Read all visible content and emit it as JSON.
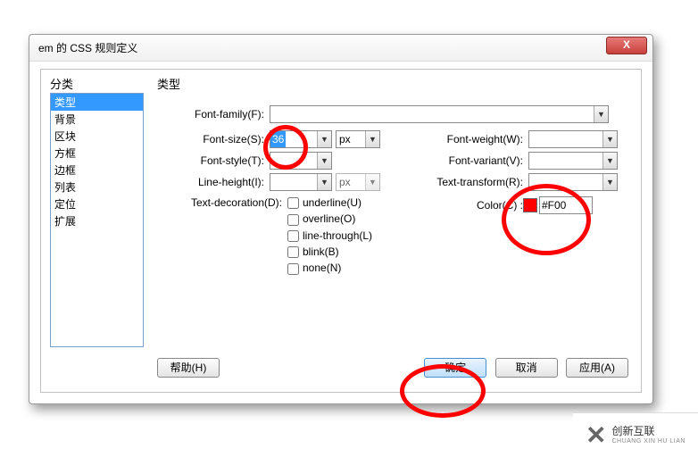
{
  "title": "em 的 CSS 规则定义",
  "close_x": "X",
  "headers": {
    "category": "分类",
    "type": "类型"
  },
  "categories": [
    "类型",
    "背景",
    "区块",
    "方框",
    "边框",
    "列表",
    "定位",
    "扩展"
  ],
  "labels": {
    "font_family": "Font-family(F):",
    "font_size": "Font-size(S):",
    "font_style": "Font-style(T):",
    "line_height": "Line-height(I):",
    "text_decoration": "Text-decoration(D):",
    "font_weight": "Font-weight(W):",
    "font_variant": "Font-variant(V):",
    "text_transform": "Text-transform(R):",
    "color": "Color(C) :"
  },
  "values": {
    "font_size": "36",
    "font_size_unit": "px",
    "line_height_unit": "px",
    "color_hex": "#F00",
    "color_swatch": "#ff0000"
  },
  "decorations": {
    "underline": "underline(U)",
    "overline": "overline(O)",
    "line_through": "line-through(L)",
    "blink": "blink(B)",
    "none": "none(N)"
  },
  "buttons": {
    "help": "帮助(H)",
    "ok": "确定",
    "cancel": "取消",
    "apply": "应用(A)"
  },
  "logo": {
    "brand": "创新互联",
    "pinyin": "CHUANG XIN HU LIAN"
  }
}
